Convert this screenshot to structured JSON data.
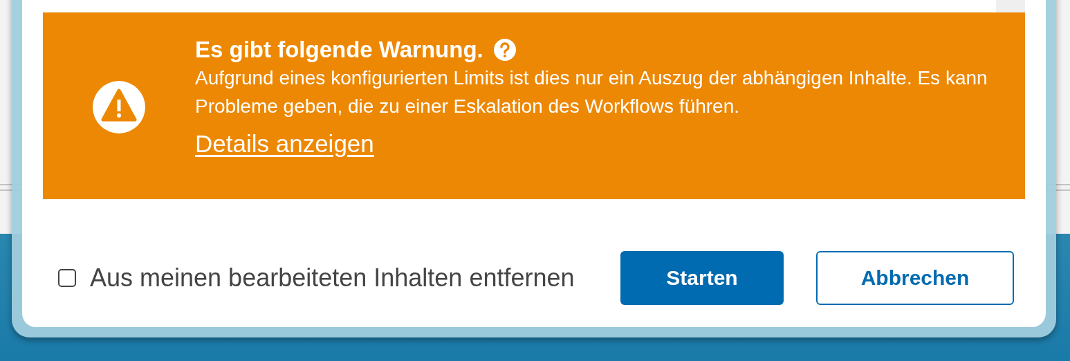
{
  "warning": {
    "title": "Es gibt folgende Warnung.",
    "message": "Aufgrund eines konfigurierten Limits ist dies nur ein Auszug der abhängigen Inhalte. Es kann Probleme geben, die zu einer Eskalation des Workflows führen.",
    "link": "Details anzeigen"
  },
  "checkbox": {
    "label": "Aus meinen bearbeiteten Inhalten entfernen",
    "checked": false
  },
  "buttons": [
    {
      "label": "Starten",
      "kind": "primary"
    },
    {
      "label": "Abbrechen",
      "kind": "secondary"
    }
  ]
}
